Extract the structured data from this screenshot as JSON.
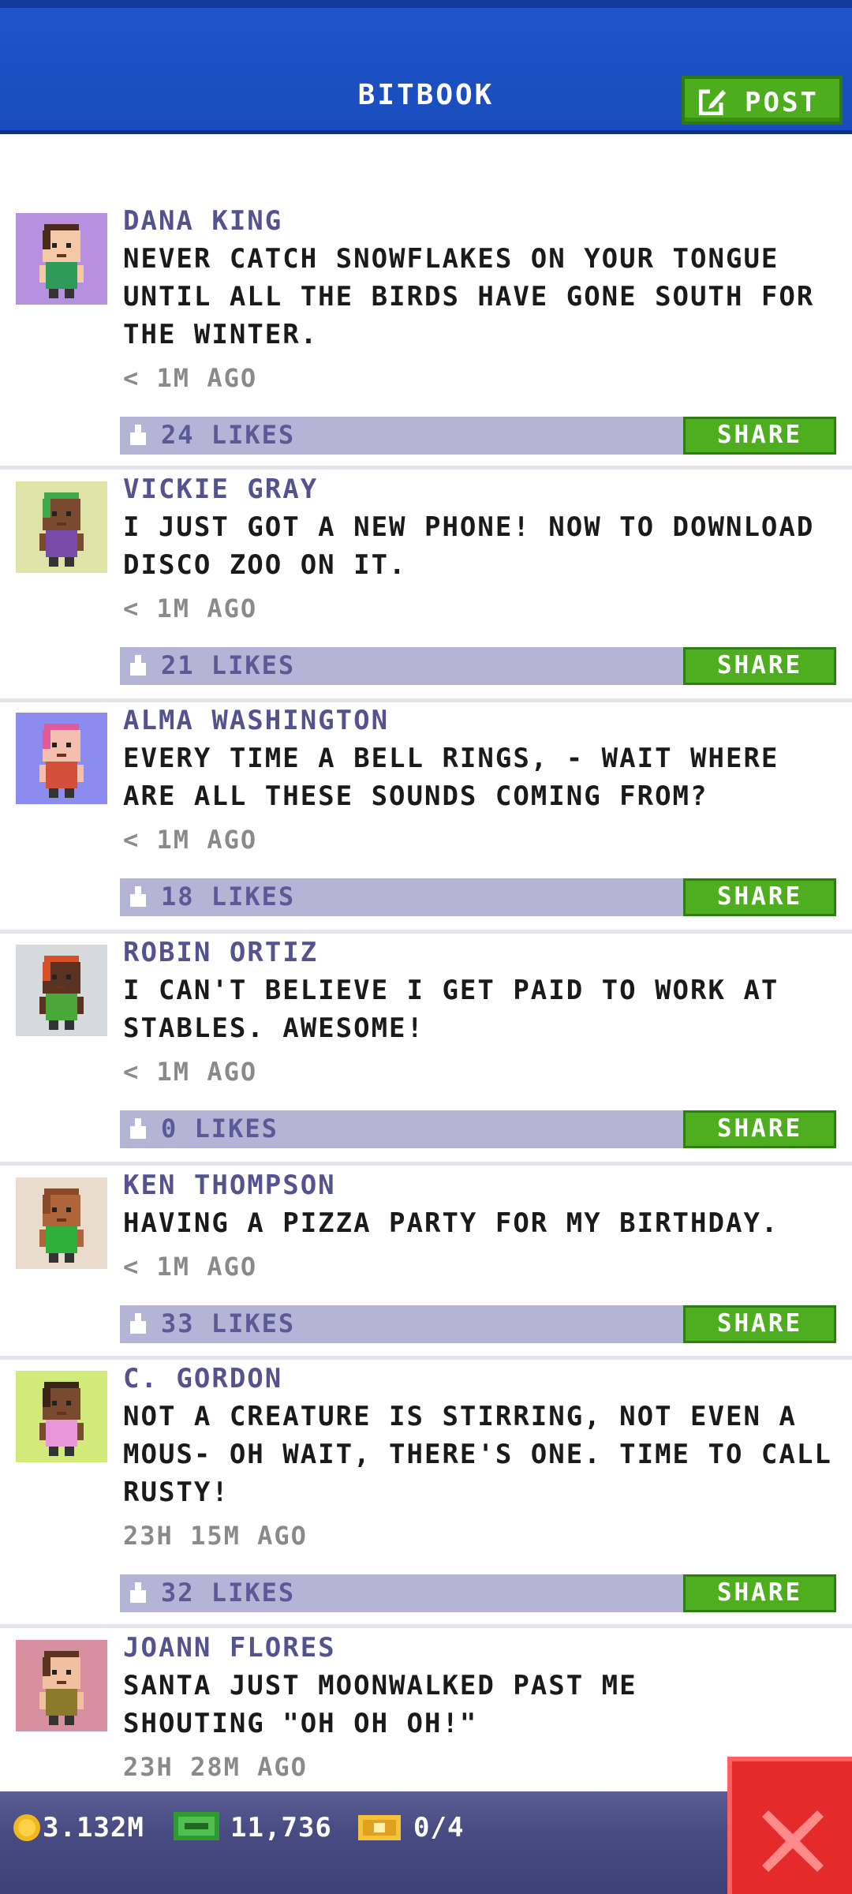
{
  "header": {
    "title": "BITBOOK",
    "post_label": "POST"
  },
  "colors": {
    "header_blue": "#1a4cbd",
    "like_bar": "#b4b5d6",
    "share_green": "#4fae1f",
    "close_red": "#e42a2a",
    "author_purple": "#55538f"
  },
  "posts": [
    {
      "author": "DANA KING",
      "message": "NEVER CATCH SNOWFLAKES ON YOUR TONGUE UNTIL ALL THE BIRDS HAVE GONE SOUTH FOR THE WINTER.",
      "time": "< 1M AGO",
      "likes": "24 LIKES",
      "share": "SHARE",
      "avatar_bg": "#b890e0",
      "skin": "#f3c9a8",
      "hair": "#4a2a1a",
      "shirt": "#2f9a5a"
    },
    {
      "author": "VICKIE GRAY",
      "message": "I JUST GOT A NEW PHONE! NOW TO DOWNLOAD DISCO ZOO ON IT.",
      "time": "< 1M AGO",
      "likes": "21 LIKES",
      "share": "SHARE",
      "avatar_bg": "#dfe3a8",
      "skin": "#7a4a2e",
      "hair": "#3fa84a",
      "shirt": "#7a4aa8"
    },
    {
      "author": "ALMA WASHINGTON",
      "message": "EVERY TIME A BELL RINGS, - WAIT WHERE ARE ALL THESE SOUNDS COMING FROM?",
      "time": "< 1M AGO",
      "likes": "18 LIKES",
      "share": "SHARE",
      "avatar_bg": "#8c8cf0",
      "skin": "#f3c0b0",
      "hair": "#e05a9a",
      "shirt": "#d0503a"
    },
    {
      "author": "ROBIN ORTIZ",
      "message": "I CAN'T BELIEVE I GET PAID TO WORK AT STABLES. AWESOME!",
      "time": "< 1M AGO",
      "likes": "0 LIKES",
      "share": "SHARE",
      "avatar_bg": "#d6dadc",
      "skin": "#5a3220",
      "hair": "#d8502a",
      "shirt": "#4aa83a"
    },
    {
      "author": "KEN THOMPSON",
      "message": "HAVING A PIZZA PARTY FOR MY BIRTHDAY.",
      "time": "< 1M AGO",
      "likes": "33 LIKES",
      "share": "SHARE",
      "avatar_bg": "#eadccc",
      "skin": "#b0643a",
      "hair": "#8a4a2a",
      "shirt": "#2fb03a"
    },
    {
      "author": "C. GORDON",
      "message": "NOT A CREATURE IS STIRRING, NOT EVEN A MOUS- OH WAIT, THERE'S ONE. TIME TO CALL RUSTY!",
      "time": "23H 15M AGO",
      "likes": "32 LIKES",
      "share": "SHARE",
      "avatar_bg": "#d2ea7a",
      "skin": "#7a4a30",
      "hair": "#3a2418",
      "shirt": "#e898d8"
    },
    {
      "author": "JOANN FLORES",
      "message": "SANTA JUST MOONWALKED PAST ME SHOUTING \"OH OH OH!\"",
      "time": "23H 28M AGO",
      "likes": "",
      "share": "",
      "avatar_bg": "#d890a0",
      "skin": "#f0c0a0",
      "hair": "#5a3420",
      "shirt": "#8a7a2a"
    }
  ],
  "bottom_bar": {
    "coins": "3.132M",
    "cash": "11,736",
    "tickets": "0/4"
  },
  "icons": {
    "post": "edit-icon",
    "like": "thumbs-up-icon",
    "coin": "coin-icon",
    "cash": "cash-icon",
    "ticket": "ticket-icon",
    "close": "close-icon"
  }
}
